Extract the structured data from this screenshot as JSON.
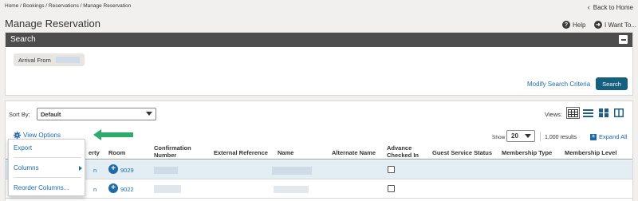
{
  "breadcrumb": "Home / Bookings / Reservations / Manage Reservation",
  "back_home": "Back to Home",
  "page_title": "Manage Reservation",
  "help_label": "Help",
  "i_want_label": "I Want To...",
  "search": {
    "header": "Search",
    "chip_label": "Arrival From",
    "modify_link": "Modify Search Criteria",
    "search_button": "Search"
  },
  "results": {
    "sort_by_label": "Sort By:",
    "sort_value": "Default",
    "views_label": "Views:",
    "view_options": "View Options",
    "show_label": "Show",
    "show_value": "20",
    "results_count": "1,000 results",
    "expand_all": "Expand All",
    "columns": {
      "property_fragment": "erty",
      "room": "Room",
      "confirmation_line1": "Confirmation",
      "confirmation_line2": "Number",
      "external_reference": "External Reference",
      "name": "Name",
      "alternate_name": "Alternate Name",
      "advance_line1": "Advance",
      "advance_line2": "Checked In",
      "guest_service_status": "Guest Service Status",
      "membership_type": "Membership Type",
      "membership_level": "Membership Level"
    },
    "rows": [
      {
        "room": "9029",
        "property_fragment": "n"
      },
      {
        "room": "9022",
        "property_fragment": "n"
      }
    ]
  },
  "view_options_menu": {
    "export": "Export",
    "columns": "Columns",
    "reorder_columns": "Reorder Columns..."
  },
  "colors": {
    "accent_link": "#1e6ba8",
    "search_button": "#14607e",
    "panel_header": "#4d4d4d",
    "selected_row": "#e3eef4",
    "arrow_green": "#2eaa6a"
  },
  "icons": [
    "chevron-left-icon",
    "help-icon",
    "i-want-to-icon",
    "minus-icon",
    "gear-icon",
    "table-view-icon",
    "list-view-icon",
    "tile-view-icon",
    "split-view-icon",
    "expand-plus-icon",
    "add-room-icon",
    "chevron-right-icon",
    "arrow-left-icon"
  ]
}
